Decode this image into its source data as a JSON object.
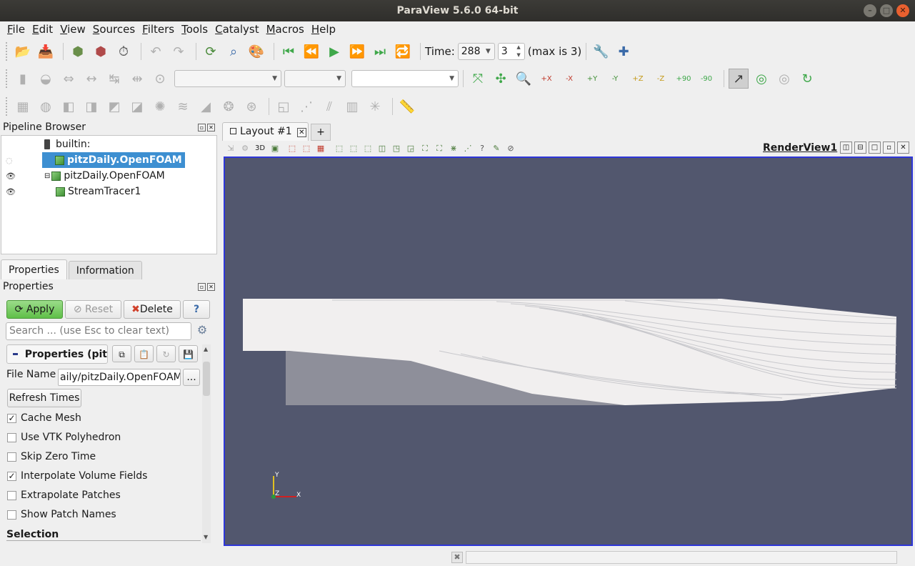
{
  "window": {
    "title": "ParaView 5.6.0 64-bit"
  },
  "menubar": {
    "items": [
      {
        "key": "F",
        "rest": "ile"
      },
      {
        "key": "E",
        "rest": "dit"
      },
      {
        "key": "V",
        "rest": "iew"
      },
      {
        "key": "S",
        "rest": "ources"
      },
      {
        "key": "F",
        "rest": "ilters"
      },
      {
        "key": "T",
        "rest": "ools"
      },
      {
        "key": "C",
        "rest": "atalyst"
      },
      {
        "key": "M",
        "rest": "acros"
      },
      {
        "key": "H",
        "rest": "elp"
      }
    ]
  },
  "toolbar": {
    "time_label": "Time:",
    "time_value": "288",
    "timestep_value": "3",
    "max_label": "(max is 3)",
    "camera_labels": {
      "px": "+X",
      "mx": "-X",
      "py": "+Y",
      "my": "-Y",
      "pz": "+Z",
      "mz": "-Z",
      "rot_p90": "+90",
      "rot_m90": "-90"
    }
  },
  "pipeline_browser": {
    "title": "Pipeline Browser",
    "items": [
      {
        "label": "builtin:"
      },
      {
        "label": "pitzDaily.OpenFOAM"
      },
      {
        "label": "pitzDaily.OpenFOAM"
      },
      {
        "label": "StreamTracer1"
      }
    ]
  },
  "tabs": {
    "properties": "Properties",
    "information": "Information"
  },
  "properties_panel": {
    "title": "Properties",
    "apply_label": "Apply",
    "reset_label": "Reset",
    "delete_label": "Delete",
    "help_label": "?",
    "search_placeholder": "Search ... (use Esc to clear text)",
    "section_label": "Properties (pit",
    "file_name_label": "File Name",
    "file_name_value": "aily/pitzDaily.OpenFOAM",
    "browse_label": "...",
    "refresh_label": "Refresh Times",
    "checkboxes": [
      {
        "label": "Cache Mesh",
        "checked": true
      },
      {
        "label": "Use VTK Polyhedron",
        "checked": false
      },
      {
        "label": "Skip Zero Time",
        "checked": false
      },
      {
        "label": "Interpolate Volume Fields",
        "checked": true
      },
      {
        "label": "Extrapolate Patches",
        "checked": false
      },
      {
        "label": "Show Patch Names",
        "checked": false
      }
    ],
    "selection_label": "Selection"
  },
  "layout": {
    "tab_label": "Layout #1",
    "add_tab": "+",
    "view_3d_label": "3D",
    "renderview_name": "RenderView1"
  },
  "render": {
    "background": "#52576e",
    "axes": {
      "y": "Y",
      "z": "Z",
      "x": "X"
    }
  },
  "colors": {
    "accent": "#3d8fd1",
    "apply_green": "#6cc455",
    "render_border": "#2e36d8"
  }
}
